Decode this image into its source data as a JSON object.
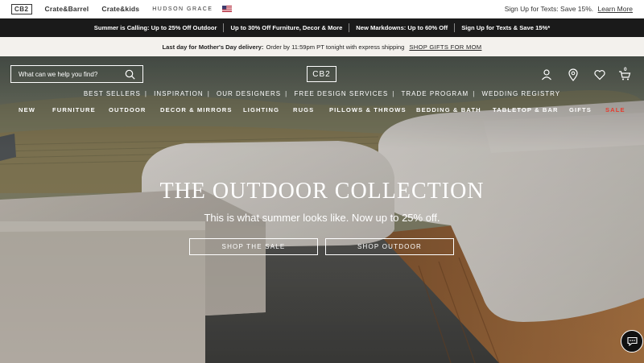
{
  "brandbar": {
    "brands": [
      "CB2",
      "Crate&Barrel",
      "Crate&kids",
      "HUDSON GRACE"
    ],
    "flag_icon": "us-flag-icon",
    "texts_prompt": "Sign Up for Texts: Save 15%.",
    "learn_more": "Learn More"
  },
  "promobar": {
    "items": [
      "Summer is Calling: Up to 25% Off Outdoor",
      "Up to 30% Off Furniture, Decor & More",
      "New Markdowns: Up to 60% Off",
      "Sign Up for Texts & Save 15%*"
    ]
  },
  "deliverybar": {
    "bold": "Last day for Mother's Day delivery:",
    "text": "Order by 11:59pm PT tonight with express shipping",
    "link": "SHOP GIFTS FOR MOM"
  },
  "header": {
    "search_placeholder": "What can we help you find?",
    "logo": "CB2",
    "cart_count": "0",
    "icons": [
      "account-icon",
      "store-locator-icon",
      "favorites-icon",
      "cart-icon"
    ]
  },
  "subnav": [
    "BEST SELLERS",
    "INSPIRATION",
    "OUR DESIGNERS",
    "FREE DESIGN SERVICES",
    "TRADE PROGRAM",
    "WEDDING REGISTRY"
  ],
  "mainnav": [
    "NEW",
    "FURNITURE",
    "OUTDOOR",
    "DECOR & MIRRORS",
    "LIGHTING",
    "RUGS",
    "PILLOWS & THROWS",
    "BEDDING & BATH",
    "TABLETOP & BAR",
    "GIFTS",
    "SALE"
  ],
  "hero": {
    "title": "THE OUTDOOR COLLECTION",
    "subtitle": "This is what summer looks like. Now up to 25% off.",
    "cta_primary": "SHOP THE SALE",
    "cta_secondary": "SHOP OUTDOOR"
  },
  "colors": {
    "sale": "#e63b2e",
    "promo_bg": "#1a1a1a",
    "delivery_bg": "#f3f1ed"
  }
}
